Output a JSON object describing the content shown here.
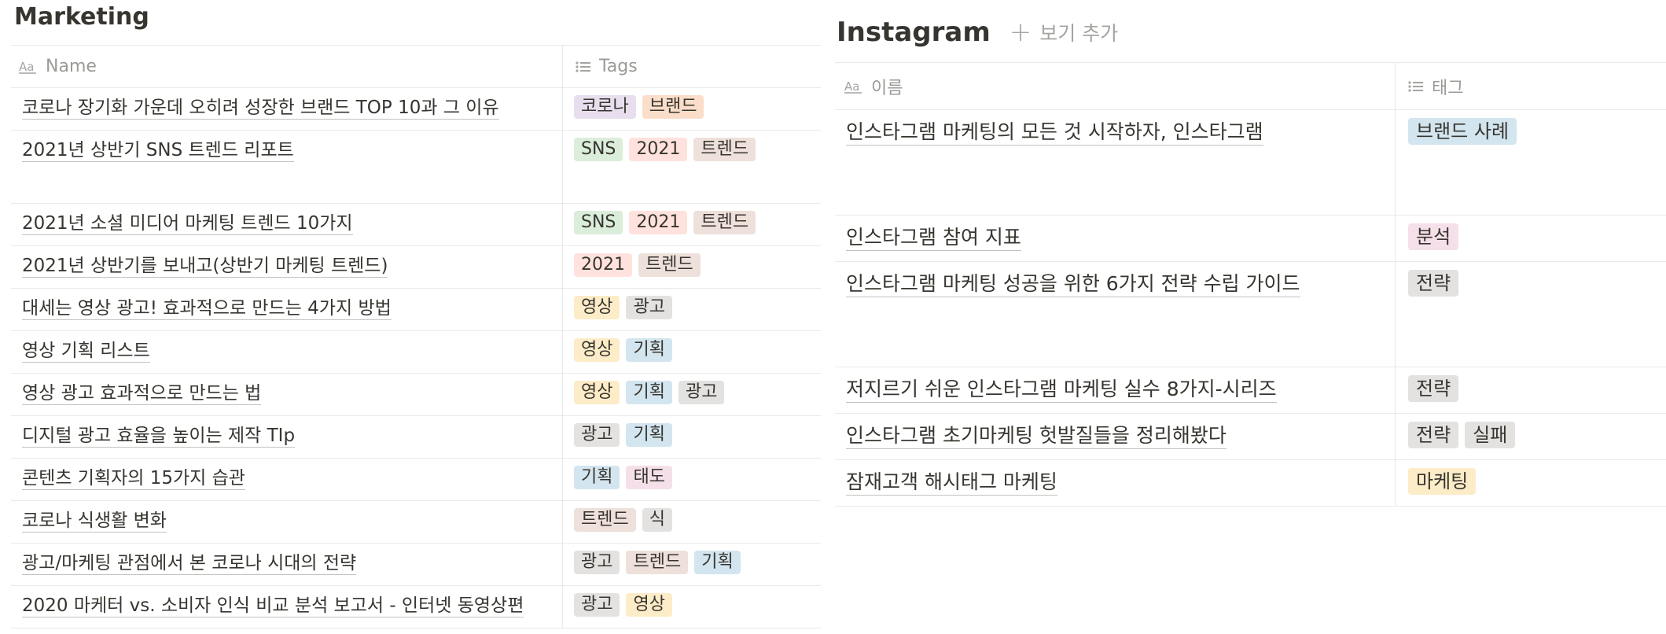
{
  "left_db": {
    "title": "Marketing",
    "columns": {
      "name": "Name",
      "tags": "Tags"
    },
    "name_icon": "text-property-icon",
    "tags_icon": "list-property-icon",
    "rows": [
      {
        "name": "코로나 장기화 가운데 오히려 성장한 브랜드 TOP 10과 그 이유",
        "tags": [
          "코로나",
          "브랜드"
        ]
      },
      {
        "name": "2021년 상반기 SNS 트렌드 리포트",
        "tags": [
          "SNS",
          "2021",
          "트렌드"
        ]
      },
      {
        "name": "2021년 소셜 미디어 마케팅 트렌드 10가지",
        "tags": [
          "SNS",
          "2021",
          "트렌드"
        ]
      },
      {
        "name": "2021년 상반기를 보내고(상반기 마케팅 트렌드)",
        "tags": [
          "2021",
          "트렌드"
        ]
      },
      {
        "name": "대세는 영상 광고! 효과적으로 만드는 4가지 방법",
        "tags": [
          "영상",
          "광고"
        ]
      },
      {
        "name": "영상 기획 리스트",
        "tags": [
          "영상",
          "기획"
        ]
      },
      {
        "name": "영상 광고 효과적으로 만드는 법",
        "tags": [
          "영상",
          "기획",
          "광고"
        ]
      },
      {
        "name": "디지털 광고 효율을 높이는 제작 TIp",
        "tags": [
          "광고",
          "기획"
        ]
      },
      {
        "name": "콘텐츠 기획자의 15가지 습관",
        "tags": [
          "기획",
          "태도"
        ]
      },
      {
        "name": "코로나 식생활 변화",
        "tags": [
          "트렌드",
          "식"
        ]
      },
      {
        "name": "광고/마케팅 관점에서 본 코로나 시대의 전략",
        "tags": [
          "광고",
          "트렌드",
          "기획"
        ]
      },
      {
        "name": "2020 마케터 vs. 소비자 인식 비교 분석 보고서 - 인터넷 동영상편",
        "tags": [
          "광고",
          "영상"
        ]
      }
    ]
  },
  "right_db": {
    "title": "Instagram",
    "add_view_label": "보기 추가",
    "columns": {
      "name": "이름",
      "tags": "태그"
    },
    "name_icon": "text-property-icon",
    "tags_icon": "list-property-icon",
    "rows": [
      {
        "name": "인스타그램 마케팅의 모든 것 시작하자, 인스타그램",
        "tags": [
          "브랜드 사례"
        ]
      },
      {
        "name": "인스타그램 참여 지표",
        "tags": [
          "분석"
        ]
      },
      {
        "name": "인스타그램 마케팅 성공을 위한 6가지 전략 수립 가이드",
        "tags": [
          "전략"
        ]
      },
      {
        "name": "저지르기 쉬운 인스타그램 마케팅 실수 8가지-시리즈",
        "tags": [
          "전략"
        ]
      },
      {
        "name": "인스타그램 초기마케팅 헛발질들을 정리해봤다",
        "tags": [
          "전략",
          "실패"
        ]
      },
      {
        "name": "잠재고객 해시태그 마케팅",
        "tags": [
          "마케팅"
        ]
      }
    ]
  },
  "tag_colors": {
    "코로나": "#e8deee",
    "브랜드": "#fadec9",
    "SNS": "#dbeddb",
    "2021": "#ffe2dd",
    "트렌드": "#eee0da",
    "영상": "#fdecc8",
    "광고": "#e3e2e0",
    "기획": "#d3e5ef",
    "태도": "#f5e0e9",
    "식": "#e3e2e0",
    "브랜드 사례": "#d3e5ef",
    "분석": "#f5e0e9",
    "전략": "#e3e2e0",
    "실패": "#e3e2e0",
    "마케팅": "#fdecc8"
  }
}
